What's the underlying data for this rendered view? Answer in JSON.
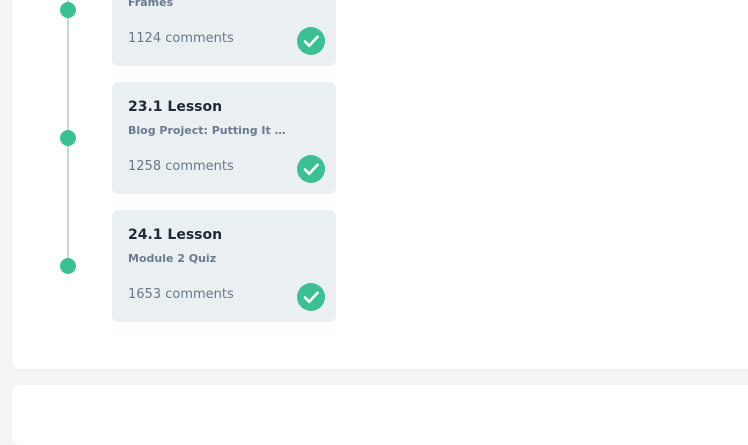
{
  "lessons": [
    {
      "title": "",
      "subtitle": "Frames",
      "comments": "1124 comments",
      "completed": true
    },
    {
      "title": "23.1 Lesson",
      "subtitle": "Blog Project: Putting It All...",
      "comments": "1258 comments",
      "completed": true
    },
    {
      "title": "24.1 Lesson",
      "subtitle": "Module 2 Quiz",
      "comments": "1653 comments",
      "completed": true
    }
  ],
  "icons": {
    "timeline_dot": "circle-dot-icon",
    "completed": "check-circle-icon"
  },
  "colors": {
    "accent": "#3dbf94",
    "card_bg": "#eaeff2",
    "timeline_line": "#c4d7d6"
  }
}
